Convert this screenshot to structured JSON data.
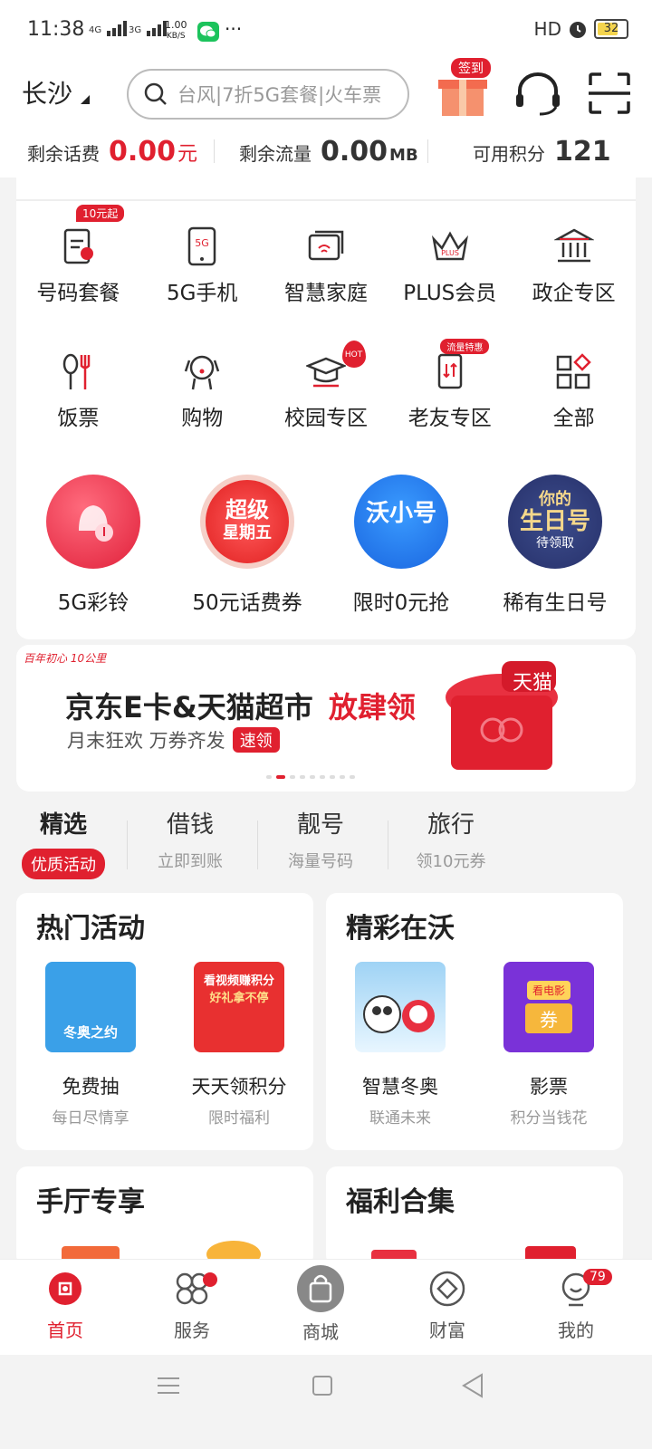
{
  "status": {
    "time": "11:38",
    "net1": "4G",
    "net2": "3G",
    "speed": "1.00",
    "speed_unit": "KB/S",
    "more": "···",
    "hd": "HD",
    "battery": "32"
  },
  "header": {
    "city": "长沙",
    "search_placeholder": "台风|7折5G套餐|火车票",
    "signin_badge": "签到"
  },
  "balance": [
    {
      "label": "剩余话费",
      "value": "0.00",
      "unit": "元"
    },
    {
      "label": "剩余流量",
      "value": "0.00",
      "unit": "MB"
    },
    {
      "label": "可用积分",
      "value": "121",
      "unit": ""
    }
  ],
  "grid": {
    "row1": [
      {
        "label": "号码套餐",
        "tag": "10元起"
      },
      {
        "label": "5G手机",
        "tag": ""
      },
      {
        "label": "智慧家庭",
        "tag": ""
      },
      {
        "label": "PLUS会员",
        "tag": ""
      },
      {
        "label": "政企专区",
        "tag": ""
      }
    ],
    "row2": [
      {
        "label": "饭票",
        "tag": ""
      },
      {
        "label": "购物",
        "tag": ""
      },
      {
        "label": "校园专区",
        "tag": "HOT"
      },
      {
        "label": "老友专区",
        "tag": "流量特惠"
      },
      {
        "label": "全部",
        "tag": ""
      }
    ],
    "icon_texts": {
      "phone5g": "5G",
      "plus": "PLUS"
    }
  },
  "promos": [
    {
      "label": "5G彩铃",
      "art": ""
    },
    {
      "label": "50元话费券",
      "art": "超级",
      "art2": "星期五"
    },
    {
      "label": "限时0元抢",
      "art": "沃小号"
    },
    {
      "label": "稀有生日号",
      "art": "你的",
      "art2": "生日号",
      "art3": "待领取"
    }
  ],
  "banner": {
    "logo": "百年初心 10公里",
    "title": "京东E卡&天猫超市",
    "highlight": "放肆领",
    "sub": "月末狂欢 万券齐发",
    "btn": "速领",
    "tmall": "天猫",
    "dots": 9,
    "active_dot": 1
  },
  "tabs": [
    {
      "title": "精选",
      "sub": "优质活动",
      "active": true
    },
    {
      "title": "借钱",
      "sub": "立即到账"
    },
    {
      "title": "靓号",
      "sub": "海量号码"
    },
    {
      "title": "旅行",
      "sub": "领10元券"
    }
  ],
  "panels": [
    {
      "title": "热门活动",
      "items": [
        {
          "name": "免费抽",
          "desc": "每日尽情享",
          "art": "冬奥之约"
        },
        {
          "name": "天天领积分",
          "desc": "限时福利",
          "art": "看视频赚积分",
          "art2": "好礼拿不停"
        }
      ]
    },
    {
      "title": "精彩在沃",
      "items": [
        {
          "name": "智慧冬奥",
          "desc": "联通未来"
        },
        {
          "name": "影票",
          "desc": "积分当钱花",
          "art": "看电影",
          "art2": "券"
        }
      ]
    },
    {
      "title": "手厅专享",
      "items": []
    },
    {
      "title": "福利合集",
      "items": []
    }
  ],
  "nav": [
    {
      "label": "首页",
      "active": true
    },
    {
      "label": "服务",
      "dot": true
    },
    {
      "label": "商城"
    },
    {
      "label": "财富"
    },
    {
      "label": "我的",
      "badge": "79"
    }
  ],
  "colors": {
    "accent": "#e0202f"
  }
}
